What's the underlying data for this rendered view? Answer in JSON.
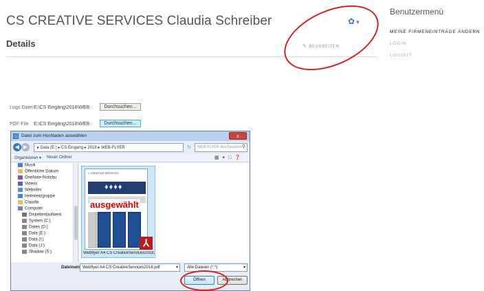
{
  "header": {
    "title": "CS CREATIVE SERVICES Claudia Schreiber",
    "gear_icon": "gear-icon",
    "details_heading": "Details",
    "edit_label": "BEARBEITEN"
  },
  "sidebar": {
    "title": "Benutzermenü",
    "links": [
      {
        "label": "MEINE FIRMENEINTRÄGE ÄNDERN"
      },
      {
        "label": "LOGIN"
      },
      {
        "label": "LOGOUT"
      }
    ]
  },
  "form": {
    "logo_label": "Logo Datei",
    "logo_path": "E:\\CS Eingang\\2018\\WEB",
    "logo_browse": "Durchsuchen...",
    "pdf_label": "PDF-File",
    "pdf_path": "E:\\CS Eingang\\2018\\WEB",
    "pdf_browse": "Durchsuchen..."
  },
  "dialog": {
    "title": "Datei zum Hochladen auswählen",
    "close_label": "x",
    "address": "▸ Data (E:) ▸ CS Eingang ▸ 2018 ▸ WEB-FLYER",
    "search_placeholder": "WEB-FLYER durchsuchen",
    "toolbar": {
      "organize": "Organisieren ▾",
      "new_folder": "Neuer Ordner"
    },
    "nav_items": [
      {
        "label": "Musik",
        "color": "#4a7cc9"
      },
      {
        "label": "Öffentliche Dokum",
        "color": "#e3c15a"
      },
      {
        "label": "OneNote-Notizbu",
        "color": "#8a4fb5"
      },
      {
        "label": "Videos",
        "color": "#4a6fa8"
      },
      {
        "label": "Websites",
        "color": "#5c8fcf"
      },
      {
        "label": "Heimnetzgruppe",
        "color": "#3d8ad6"
      },
      {
        "label": "Claudia",
        "color": "#e3c15a"
      },
      {
        "label": "Computer",
        "color": "#6c88ad"
      },
      {
        "label": "Diskettenlaufwerk",
        "color": "#777777"
      },
      {
        "label": "System (C:)",
        "color": "#888888"
      },
      {
        "label": "Daten (D:)",
        "color": "#888888"
      },
      {
        "label": "Data (E:)",
        "color": "#888888"
      },
      {
        "label": "Data (I:)",
        "color": "#888888"
      },
      {
        "label": "Data (J:)",
        "color": "#888888"
      },
      {
        "label": "Shadow (S:)",
        "color": "#888888"
      }
    ],
    "file": {
      "name": "Webflyer A4 CS CreativeServices2018.pdf",
      "stamp": "ausgewählt",
      "pdf_icon": "acrobat-icon"
    },
    "filename_label": "Dateiname:",
    "filename_value": "Webflyer A4 CS CreativeServices2018.pdf",
    "filetype_value": "Alle Dateien (*.*)",
    "open_label": "Öffnen",
    "cancel_label": "Abbrechen"
  },
  "colors": {
    "annotation_red": "#d81f1f",
    "accent_blue": "#3a7bbf"
  }
}
